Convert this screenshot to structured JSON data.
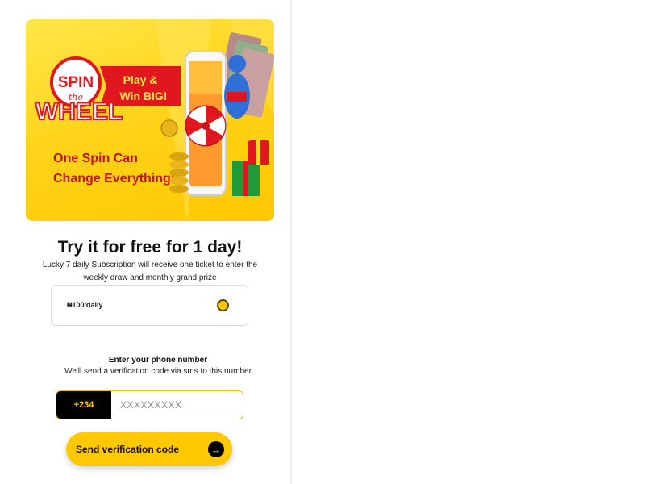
{
  "banner": {
    "spin_text": "SPIN",
    "the_text": "the",
    "wheel_text": "WHEEL",
    "ribbon_line1": "Play &",
    "ribbon_line2": "Win BIG!",
    "tagline_line1": "One Spin Can",
    "tagline_line2": "Change Everything!",
    "colors": {
      "background": "#ffd41a",
      "red": "#e0171f",
      "tagline": "#c8101a"
    }
  },
  "offer": {
    "headline": "Try it for free for 1 day!",
    "description": "Lucky 7 daily Subscription will receive one ticket to enter the weekly draw and monthly grand prize"
  },
  "plan": {
    "price_label": "₦100/daily",
    "selected": true
  },
  "phone": {
    "title": "Enter your phone number",
    "subtitle": "We'll send a verification code via sms to this number",
    "country_code": "+234",
    "placeholder": "XXXXXXXXX",
    "value": ""
  },
  "actions": {
    "send_label": "Send verification code",
    "send_icon": "arrow-right-circle-icon",
    "accent_color": "#ffc800"
  }
}
